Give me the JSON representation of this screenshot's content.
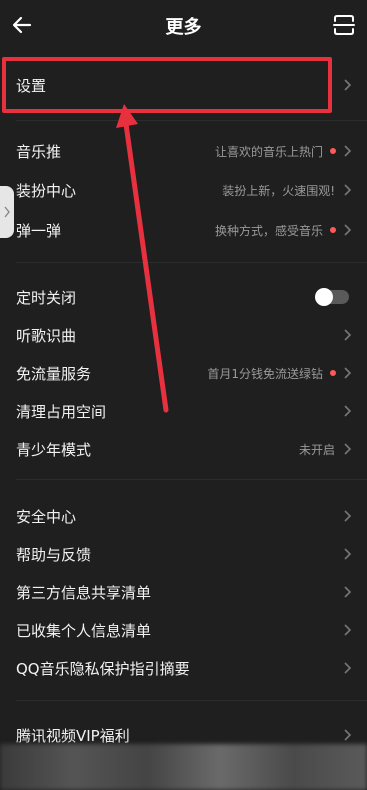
{
  "header": {
    "title": "更多",
    "back_icon": "arrow-left-icon",
    "scan_icon": "scan-icon"
  },
  "sections": {
    "settings": {
      "label": "设置"
    },
    "group1": [
      {
        "label": "音乐推",
        "desc": "让喜欢的音乐上热门",
        "dot": true
      },
      {
        "label": "装扮中心",
        "desc": "装扮上新，火速围观!",
        "dot": false
      },
      {
        "label": "弹一弹",
        "desc": "换种方式，感受音乐",
        "dot": true
      }
    ],
    "group2": [
      {
        "label": "定时关闭",
        "toggle_on": false
      },
      {
        "label": "听歌识曲",
        "desc": ""
      },
      {
        "label": "免流量服务",
        "desc": "首月1分钱免流送绿钻",
        "dot": true
      },
      {
        "label": "清理占用空间",
        "desc": ""
      },
      {
        "label": "青少年模式",
        "desc": "未开启"
      }
    ],
    "group3": [
      {
        "label": "安全中心"
      },
      {
        "label": "帮助与反馈"
      },
      {
        "label": "第三方信息共享清单"
      },
      {
        "label": "已收集个人信息清单"
      },
      {
        "label": "QQ音乐隐私保护指引摘要"
      }
    ],
    "group4": [
      {
        "label": "腾讯视频VIP福利"
      }
    ]
  },
  "colors": {
    "background": "#1f1f1f",
    "accent_red": "#e8313f",
    "dot": "#ff5a5a",
    "desc_gray": "#9a9a9a"
  }
}
